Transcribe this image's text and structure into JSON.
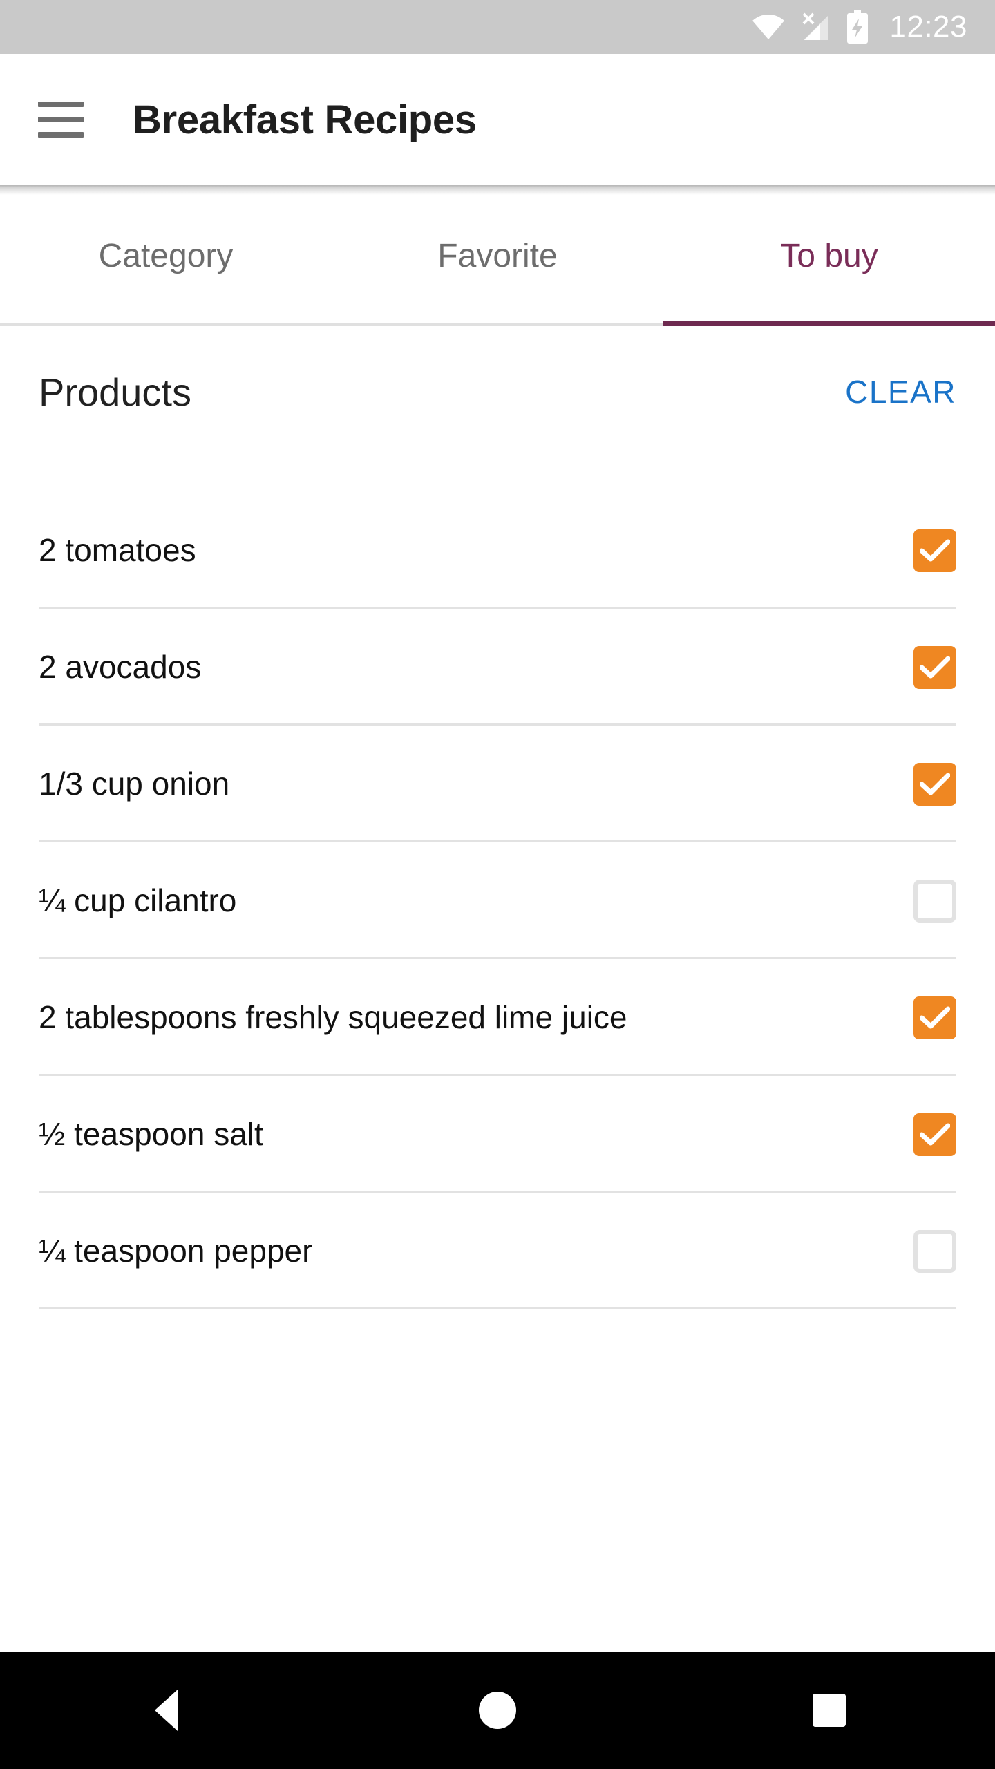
{
  "status_bar": {
    "time": "12:23",
    "icons": [
      "wifi-icon",
      "cellular-no-sim-icon",
      "battery-charging-icon"
    ],
    "background_color": "#c9c9c9"
  },
  "app_bar": {
    "menu_icon": "hamburger-menu-icon",
    "title": "Breakfast Recipes"
  },
  "tabs": {
    "items": [
      {
        "label": "Category",
        "active": false
      },
      {
        "label": "Favorite",
        "active": false
      },
      {
        "label": "To buy",
        "active": true
      }
    ],
    "active_color": "#7a2d58",
    "inactive_color": "#6d6d6d"
  },
  "section": {
    "title": "Products",
    "clear_label": "CLEAR",
    "clear_color": "#1a73c8"
  },
  "products": [
    {
      "label": "2 tomatoes",
      "checked": true
    },
    {
      "label": "2 avocados",
      "checked": true
    },
    {
      "label": "1/3 cup onion",
      "checked": true
    },
    {
      "label": "¼ cup cilantro",
      "checked": false
    },
    {
      "label": "2 tablespoons freshly squeezed lime juice",
      "checked": true
    },
    {
      "label": "½ teaspoon salt",
      "checked": true
    },
    {
      "label": "¼ teaspoon pepper",
      "checked": false
    }
  ],
  "checkbox_colors": {
    "checked_fill": "#ef8722",
    "checked_mark": "#ffffff",
    "unchecked_border": "#e2e2e2"
  },
  "nav_bar": {
    "buttons": [
      "back-button",
      "home-button",
      "recents-button"
    ],
    "background_color": "#000000"
  }
}
